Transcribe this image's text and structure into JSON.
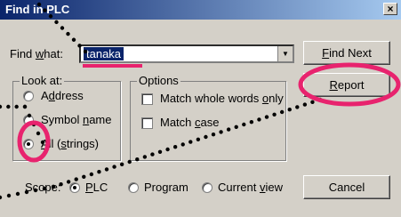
{
  "window": {
    "title": "Find in PLC",
    "close_label": "×"
  },
  "find": {
    "label_pre": "Find ",
    "label_u": "w",
    "label_post": "hat:",
    "value": "tanaka"
  },
  "buttons": {
    "find_next_pre": "",
    "find_next_u": "F",
    "find_next_post": "ind Next",
    "report_pre": "",
    "report_u": "R",
    "report_post": "eport",
    "cancel": "Cancel"
  },
  "look_at": {
    "title": "Look at:",
    "options": [
      {
        "pre": "A",
        "u": "d",
        "post": "dress",
        "selected": false
      },
      {
        "pre": "Symbol ",
        "u": "n",
        "post": "ame",
        "selected": false
      },
      {
        "pre": "",
        "u": "A",
        "post": "ll (",
        "u2": "s",
        "post2": "trings)",
        "selected": true
      }
    ]
  },
  "options": {
    "title": "Options",
    "items": [
      {
        "pre": "Match whole words ",
        "u": "o",
        "post": "nly",
        "checked": false
      },
      {
        "pre": "Match ",
        "u": "c",
        "post": "ase",
        "checked": false
      }
    ]
  },
  "scope": {
    "label": "Scope:",
    "options": [
      {
        "pre": "",
        "u": "P",
        "post": "LC",
        "selected": true
      },
      {
        "pre": "Program",
        "u": "",
        "post": "",
        "selected": false
      },
      {
        "pre": "Current ",
        "u": "v",
        "post": "iew",
        "selected": false
      }
    ]
  },
  "annotation": {
    "circle_color": "#e8236e",
    "dot_color": "#000000"
  }
}
